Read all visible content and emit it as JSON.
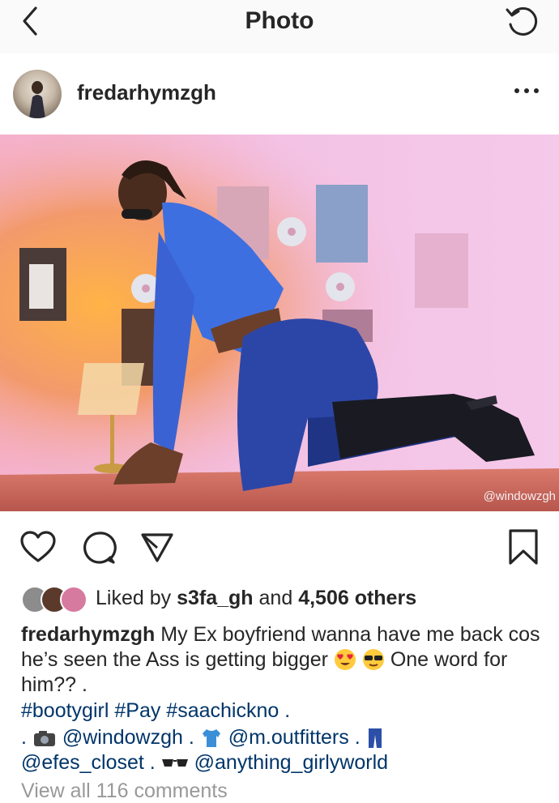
{
  "colors": {
    "text": "#262626",
    "link": "#003569",
    "muted": "#999999",
    "divider": "#e3e3e3"
  },
  "topbar": {
    "title": "Photo",
    "back_icon": "chevron-left-icon",
    "right_icon": "refresh-icon"
  },
  "post": {
    "username": "fredarhymzgh",
    "more_icon": "more-horizontal-icon",
    "photo_watermark": "@windowzgh"
  },
  "actions": {
    "icons": [
      "heart-icon",
      "comment-icon",
      "share-icon",
      "bookmark-icon"
    ]
  },
  "likes": {
    "prefix": "Liked by",
    "user": "s3fa_gh",
    "joiner": "and",
    "others": "4,506 others"
  },
  "caption": {
    "username": "fredarhymzgh",
    "text_part1": "My Ex boyfriend wanna have me back cos he’s seen the Ass is getting bigger",
    "text_part2": "One word for him?? .",
    "emojis": [
      "heart-eyes-emoji",
      "sunglasses-emoji"
    ]
  },
  "hashtags": [
    "#bootygirl",
    "#Pay",
    "#saachickno",
    "."
  ],
  "credits": {
    "lead": ". ",
    "mention1": "@windowzgh",
    "sep1": " . ",
    "mention2": "@m.outfitters",
    "sep2": " . ",
    "mention3": "@efes_closet",
    "sep3": " . ",
    "mention4": "@anything_girlyworld"
  },
  "comments": {
    "view_all": "View all 116 comments"
  }
}
